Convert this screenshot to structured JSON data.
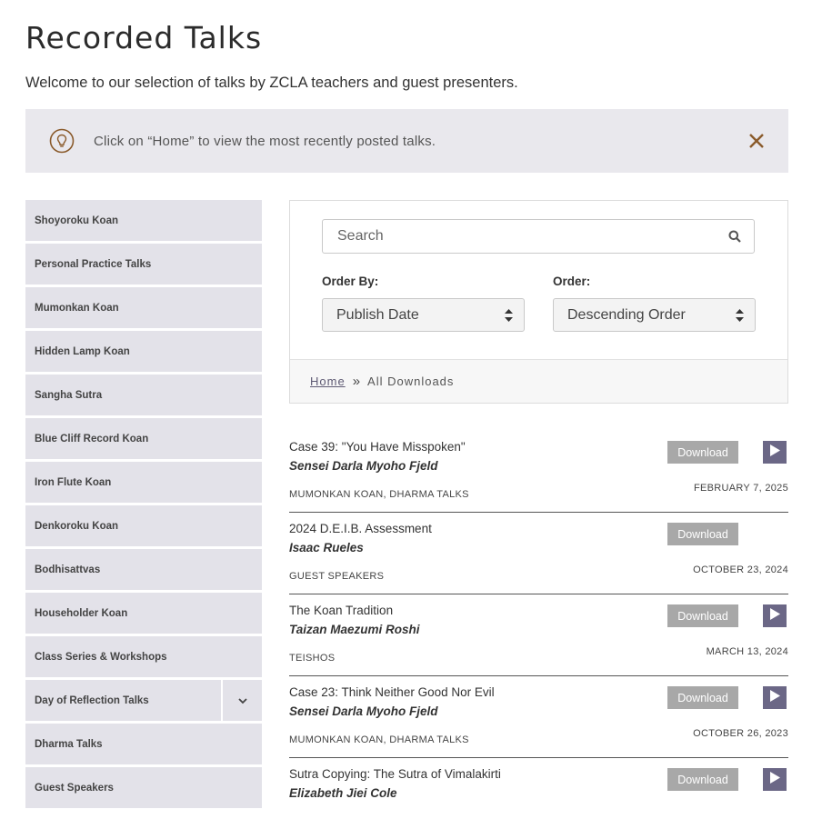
{
  "page": {
    "title": "Recorded Talks",
    "subtitle": "Welcome to our selection of talks by ZCLA teachers and guest presenters."
  },
  "notice": {
    "text": "Click on “Home” to view the most recently posted talks.",
    "icon": "lightbulb-icon",
    "accent_color": "#8a5a2b"
  },
  "sidebar": {
    "items": [
      {
        "label": "Shoyoroku Koan"
      },
      {
        "label": "Personal Practice Talks"
      },
      {
        "label": "Mumonkan Koan"
      },
      {
        "label": "Hidden Lamp Koan"
      },
      {
        "label": "Sangha Sutra"
      },
      {
        "label": "Blue Cliff Record Koan"
      },
      {
        "label": "Iron Flute Koan"
      },
      {
        "label": "Denkoroku Koan"
      },
      {
        "label": "Bodhisattvas"
      },
      {
        "label": "Householder Koan"
      },
      {
        "label": "Class Series & Workshops"
      },
      {
        "label": "Day of Reflection Talks",
        "expandable": true
      },
      {
        "label": "Dharma Talks"
      },
      {
        "label": "Guest Speakers"
      }
    ]
  },
  "filters": {
    "search_placeholder": "Search",
    "search_value": "",
    "order_by_label": "Order By:",
    "order_by_value": "Publish Date",
    "order_label": "Order:",
    "order_value": "Descending Order"
  },
  "breadcrumb": {
    "home": "Home",
    "separator": "»",
    "current": "All Downloads"
  },
  "talks": [
    {
      "title": "Case 39: \"You Have Misspoken\"",
      "speaker": "Sensei Darla Myoho Fjeld",
      "categories": [
        "MUMONKAN KOAN",
        "DHARMA TALKS"
      ],
      "date": "FEBRUARY 7, 2025",
      "download_label": "Download",
      "has_play": true
    },
    {
      "title": "2024 D.E.I.B. Assessment",
      "speaker": "Isaac Rueles",
      "categories": [
        "GUEST SPEAKERS"
      ],
      "date": "OCTOBER 23, 2024",
      "download_label": "Download",
      "has_play": false
    },
    {
      "title": "The Koan Tradition",
      "speaker": "Taizan Maezumi Roshi",
      "categories": [
        "TEISHOS"
      ],
      "date": "MARCH 13, 2024",
      "download_label": "Download",
      "has_play": true
    },
    {
      "title": "Case 23: Think Neither Good Nor Evil",
      "speaker": "Sensei Darla Myoho Fjeld",
      "categories": [
        "MUMONKAN KOAN",
        "DHARMA TALKS"
      ],
      "date": "OCTOBER 26, 2023",
      "download_label": "Download",
      "has_play": true
    },
    {
      "title": "Sutra Copying: The Sutra of Vimalakirti",
      "speaker": "Elizabeth Jiei Cole",
      "categories": [],
      "date": "",
      "download_label": "Download",
      "has_play": true
    }
  ],
  "colors": {
    "sidebar_bg": "#e3e2e9",
    "notice_bg": "#e9e8ed",
    "download_bg": "#a8a8a8",
    "play_bg": "#6b6786"
  }
}
